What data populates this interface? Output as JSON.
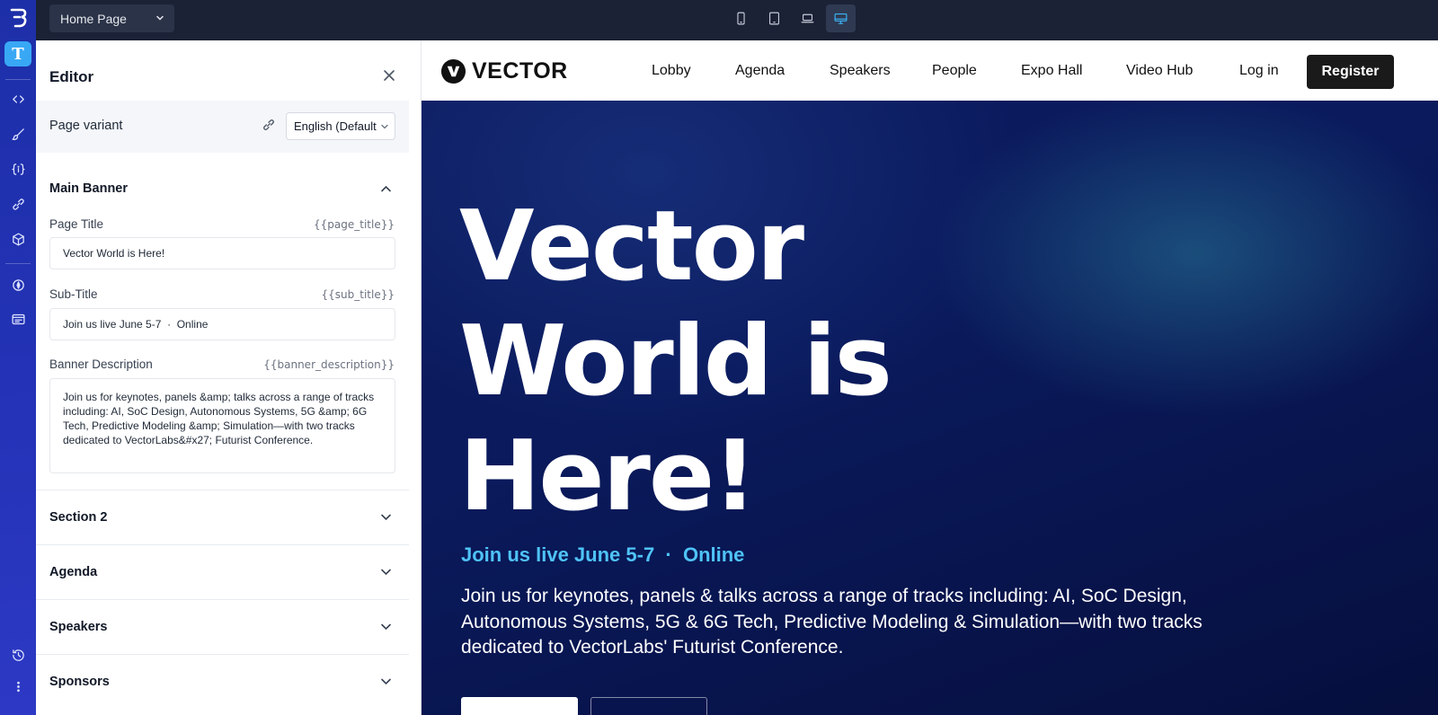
{
  "topbar": {
    "page_select": "Home Page",
    "devices": [
      "mobile-device",
      "tablet-device",
      "laptop-device",
      "desktop-device"
    ]
  },
  "editor": {
    "title": "Editor",
    "variant_label": "Page variant",
    "variant_value": "English (Default",
    "sections": {
      "main_banner": {
        "title": "Main Banner",
        "fields": {
          "page_title": {
            "label": "Page Title",
            "tag": "{{page_title}}",
            "value": "Vector World is Here!"
          },
          "sub_title": {
            "label": "Sub-Title",
            "tag": "{{sub_title}}",
            "value": "Join us live June 5-7  ·  Online"
          },
          "banner_description": {
            "label": "Banner Description",
            "tag": "{{banner_description}}",
            "value": "Join us for keynotes, panels &amp; talks across a range of tracks including: AI, SoC Design, Autonomous Systems, 5G &amp; 6G Tech, Predictive Modeling &amp; Simulation—with two tracks dedicated to VectorLabs&#x27; Futurist Conference."
          }
        }
      },
      "others": [
        "Section 2",
        "Agenda",
        "Speakers",
        "Sponsors"
      ]
    }
  },
  "preview": {
    "brand": "VECTOR",
    "nav": [
      "Lobby",
      "Agenda",
      "Speakers",
      "People",
      "Expo Hall",
      "Video Hub",
      "Log in"
    ],
    "register": "Register",
    "hero_title": "Vector World is Here!",
    "hero_sub": "Join us live June 5-7  ·  Online",
    "hero_desc": "Join us for keynotes, panels & talks across a range of tracks including: AI, SoC Design, Autonomous Systems, 5G & 6G Tech, Predictive Modeling & Simulation—with two tracks dedicated to VectorLabs' Futurist Conference."
  },
  "colors": {
    "rail": "#2433b8",
    "topbar": "#1b2236",
    "accent": "#38a8f5",
    "hero_bg": "#0a1a5c",
    "hero_sub": "#4fc3f7"
  }
}
